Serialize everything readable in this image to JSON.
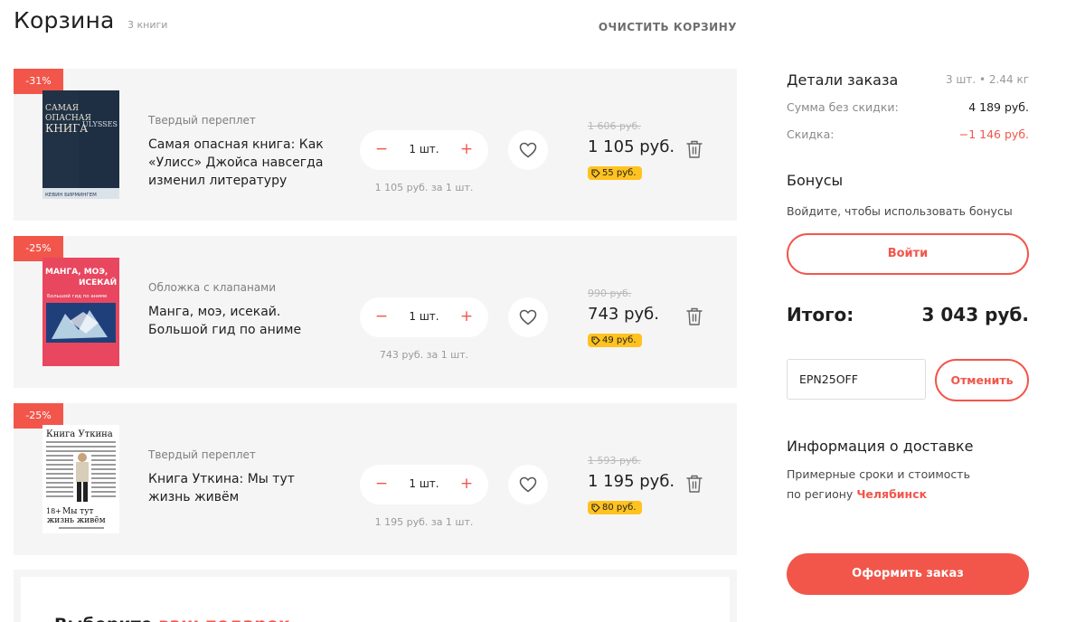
{
  "header": {
    "title": "Корзина",
    "count": "3 книги",
    "clear_label": "ОЧИСТИТЬ КОРЗИНУ"
  },
  "items": [
    {
      "discount": "-31%",
      "binding": "Твердый переплет",
      "title": "Самая опасная книга: Как «Улисс» Джойса навсегда изменил литературу",
      "qty": "1 шт.",
      "unit_price": "1 105 руб. за 1 шт.",
      "old_price": "1 606 руб.",
      "price": "1 105 руб.",
      "bonus": "55 руб.",
      "cover": {
        "title_lines": [
          "САМАЯ",
          "ОПАСНАЯ",
          "КНИГА"
        ],
        "spine": "ULYSSES",
        "author": "КЕВИН БИРМИНГЕМ"
      }
    },
    {
      "discount": "-25%",
      "binding": "Обложка с клапанами",
      "title": "Манга, моэ, исекай. Большой гид по аниме",
      "qty": "1 шт.",
      "unit_price": "743 руб. за 1 шт.",
      "old_price": "990 руб.",
      "price": "743 руб.",
      "bonus": "49 руб.",
      "cover": {
        "title_lines": [
          "МАНГА, МОЭ,",
          "ИСЕКАЙ"
        ],
        "subtitle": "Большой гид по аниме"
      }
    },
    {
      "discount": "-25%",
      "binding": "Твердый переплет",
      "title": "Книга Уткина: Мы тут жизнь живём",
      "qty": "1 шт.",
      "unit_price": "1 195 руб. за 1 шт.",
      "old_price": "1 593 руб.",
      "price": "1 195 руб.",
      "bonus": "80 руб.",
      "cover": {
        "title": "Книга Уткина",
        "age": "18+",
        "bottom_lines": [
          "Мы тут",
          "жизнь живём"
        ]
      }
    }
  ],
  "gift": {
    "title": "Выберите",
    "accent": "ваш подарок"
  },
  "sidebar": {
    "order_title": "Детали заказа",
    "order_meta": "3 шт. • 2.44 кг",
    "sum_label": "Сумма без скидки:",
    "sum_value": "4 189 руб.",
    "discount_label": "Скидка:",
    "discount_value": "−1 146 руб.",
    "bonus_title": "Бонусы",
    "bonus_hint": "Войдите, чтобы использовать бонусы",
    "login_label": "Войти",
    "total_label": "Итого:",
    "total_value": "3 043 руб.",
    "promo_value": "EPN25OFF",
    "cancel_label": "Отменить",
    "delivery_title": "Информация о доставке",
    "delivery_text": "Примерные сроки и стоимость",
    "delivery_prefix": "по региону",
    "delivery_city": "Челябинск",
    "checkout_label": "Оформить заказ"
  },
  "icons": {
    "minus": "−",
    "plus": "+"
  },
  "colors": {
    "accent": "#f2564b",
    "bonus_badge": "#ffc21f",
    "item_background": "#f5f5f5"
  }
}
